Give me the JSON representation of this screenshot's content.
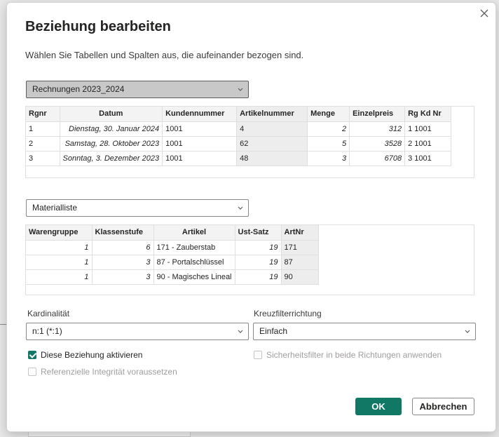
{
  "dialog": {
    "title": "Beziehung bearbeiten",
    "subtitle": "Wählen Sie Tabellen und Spalten aus, die aufeinander bezogen sind."
  },
  "table1": {
    "selected": "Rechnungen 2023_2024",
    "headers": [
      "Rgnr",
      "Datum",
      "Kundennummer",
      "Artikelnummer",
      "Menge",
      "Einzelpreis",
      "Rg Kd Nr"
    ],
    "rows": [
      [
        "1",
        "Dienstag, 30. Januar 2024",
        "1001",
        "4",
        "2",
        "312",
        "1 1001"
      ],
      [
        "2",
        "Samstag, 28. Oktober 2023",
        "1001",
        "62",
        "5",
        "3528",
        "2 1001"
      ],
      [
        "3",
        "Sonntag, 3. Dezember 2023",
        "1001",
        "48",
        "3",
        "6708",
        "3 1001"
      ]
    ]
  },
  "table2": {
    "selected": "Materialliste",
    "headers": [
      "Warengruppe",
      "Klassenstufe",
      "Artikel",
      "Ust-Satz",
      "ArtNr"
    ],
    "rows": [
      [
        "1",
        "6",
        "171 - Zauberstab",
        "19",
        "171"
      ],
      [
        "1",
        "3",
        "87 - Portalschlüssel",
        "19",
        "87"
      ],
      [
        "1",
        "3",
        "90 - Magisches Lineal",
        "19",
        "90"
      ]
    ]
  },
  "cardinality": {
    "label": "Kardinalität",
    "value": "n:1 (*:1)"
  },
  "crossfilter": {
    "label": "Kreuzfilterrichtung",
    "value": "Einfach"
  },
  "options": {
    "activate": "Diese Beziehung aktivieren",
    "security_filter": "Sicherheitsfilter in beide Richtungen anwenden",
    "ref_integrity": "Referenzielle Integrität voraussetzen"
  },
  "buttons": {
    "ok": "OK",
    "cancel": "Abbrechen"
  },
  "colors": {
    "accent": "#117865"
  }
}
